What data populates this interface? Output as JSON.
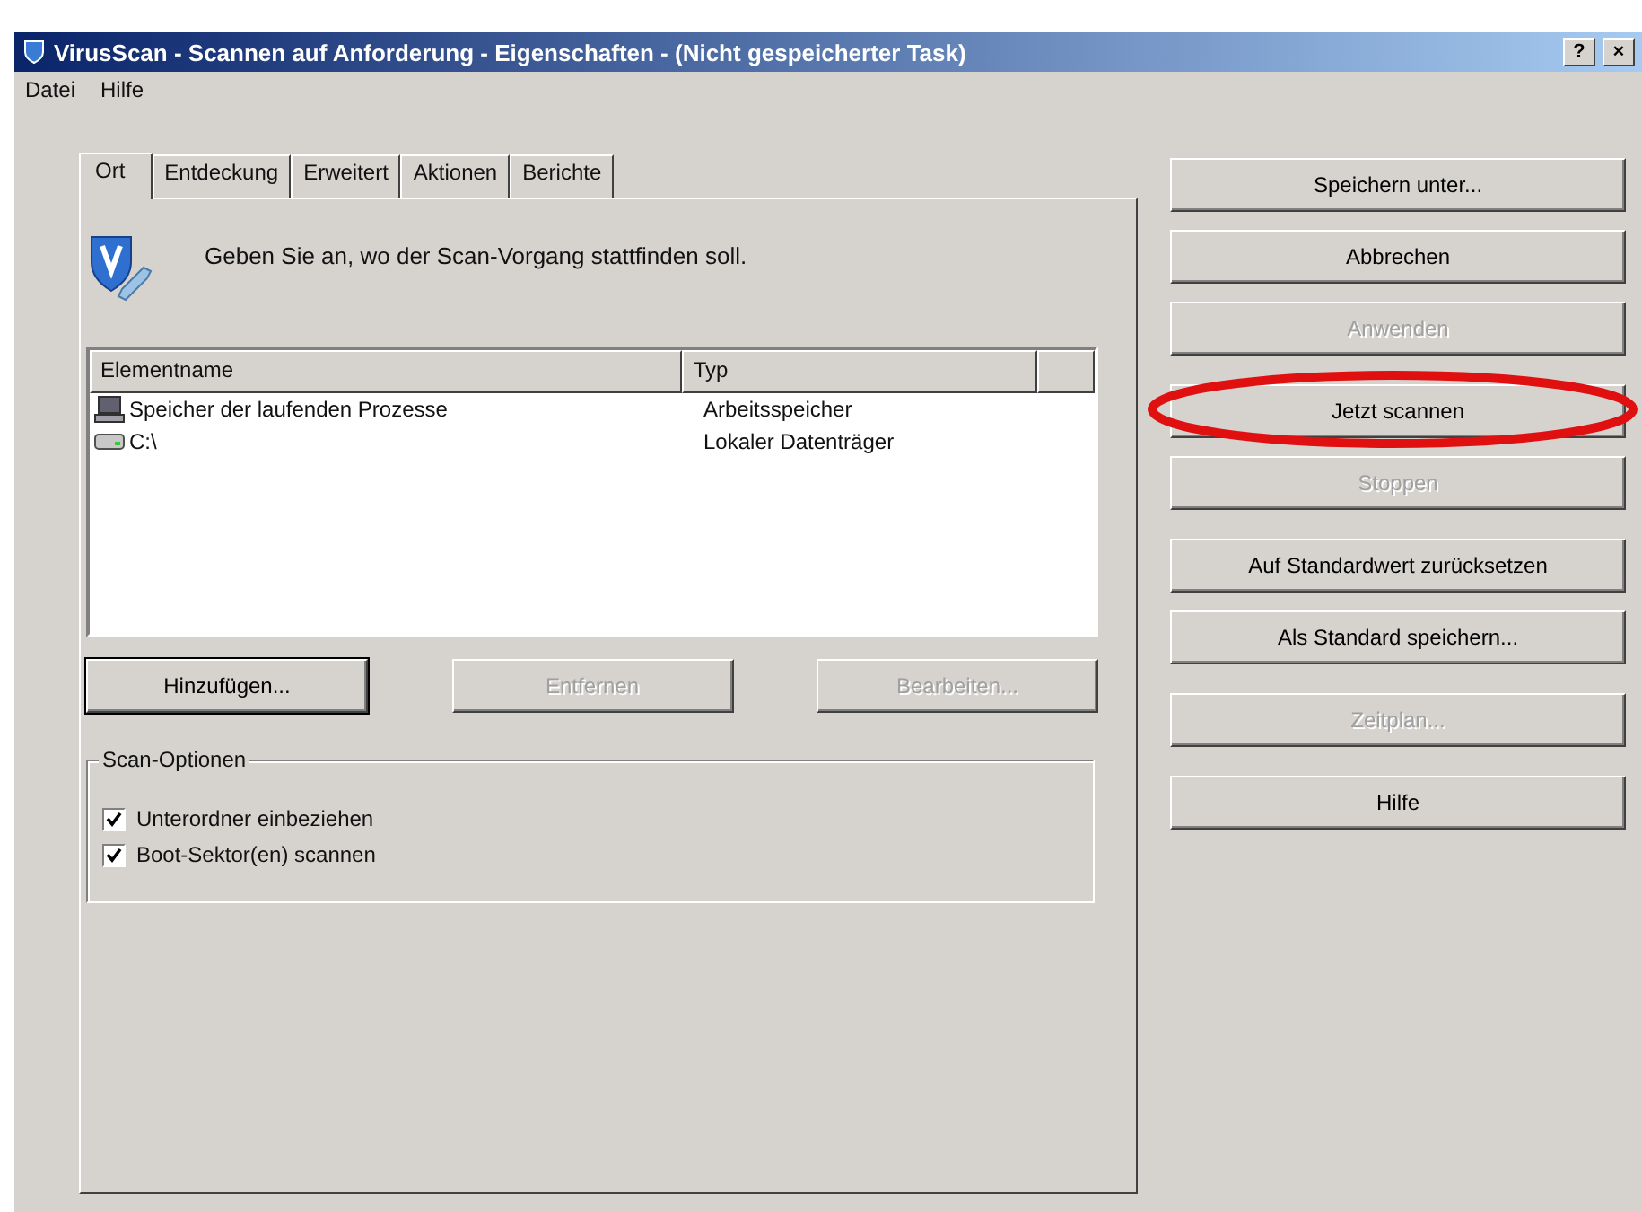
{
  "window": {
    "title": "VirusScan - Scannen auf Anforderung - Eigenschaften - (Nicht gespeicherter Task)",
    "caption_buttons": [
      "?",
      "×"
    ]
  },
  "menu": [
    "Datei",
    "Hilfe"
  ],
  "tabs": [
    {
      "label": "Ort",
      "selected": true
    },
    {
      "label": "Entdeckung",
      "selected": false
    },
    {
      "label": "Erweitert",
      "selected": false
    },
    {
      "label": "Aktionen",
      "selected": false
    },
    {
      "label": "Berichte",
      "selected": false
    }
  ],
  "intro": "Geben Sie an, wo der Scan-Vorgang stattfinden soll.",
  "list": {
    "columns": [
      "Elementname",
      "Typ"
    ],
    "rows": [
      {
        "kind": "memory",
        "name": "Speicher der laufenden Prozesse",
        "type": "Arbeitsspeicher"
      },
      {
        "kind": "drive",
        "name": "C:\\",
        "type": "Lokaler Datenträger"
      }
    ]
  },
  "list_buttons": [
    {
      "label": "Hinzufügen...",
      "disabled": false,
      "default": true
    },
    {
      "label": "Entfernen",
      "disabled": true,
      "default": false
    },
    {
      "label": "Bearbeiten...",
      "disabled": true,
      "default": false
    }
  ],
  "scan_options": {
    "title": "Scan-Optionen",
    "items": [
      {
        "label": "Unterordner einbeziehen",
        "checked": true
      },
      {
        "label": "Boot-Sektor(en) scannen",
        "checked": true
      }
    ]
  },
  "side_buttons": [
    [
      {
        "label": "Speichern unter...",
        "disabled": false,
        "circled": false
      },
      {
        "label": "Abbrechen",
        "disabled": false,
        "circled": false
      },
      {
        "label": "Anwenden",
        "disabled": true,
        "circled": false
      }
    ],
    [
      {
        "label": "Jetzt scannen",
        "disabled": false,
        "circled": true
      },
      {
        "label": "Stoppen",
        "disabled": true,
        "circled": false
      }
    ],
    [
      {
        "label": "Auf Standardwert zurücksetzen",
        "disabled": false,
        "circled": false
      },
      {
        "label": "Als Standard speichern...",
        "disabled": false,
        "circled": false
      }
    ],
    [
      {
        "label": "Zeitplan...",
        "disabled": true,
        "circled": false
      }
    ],
    [
      {
        "label": "Hilfe",
        "disabled": false,
        "circled": false
      }
    ]
  ]
}
